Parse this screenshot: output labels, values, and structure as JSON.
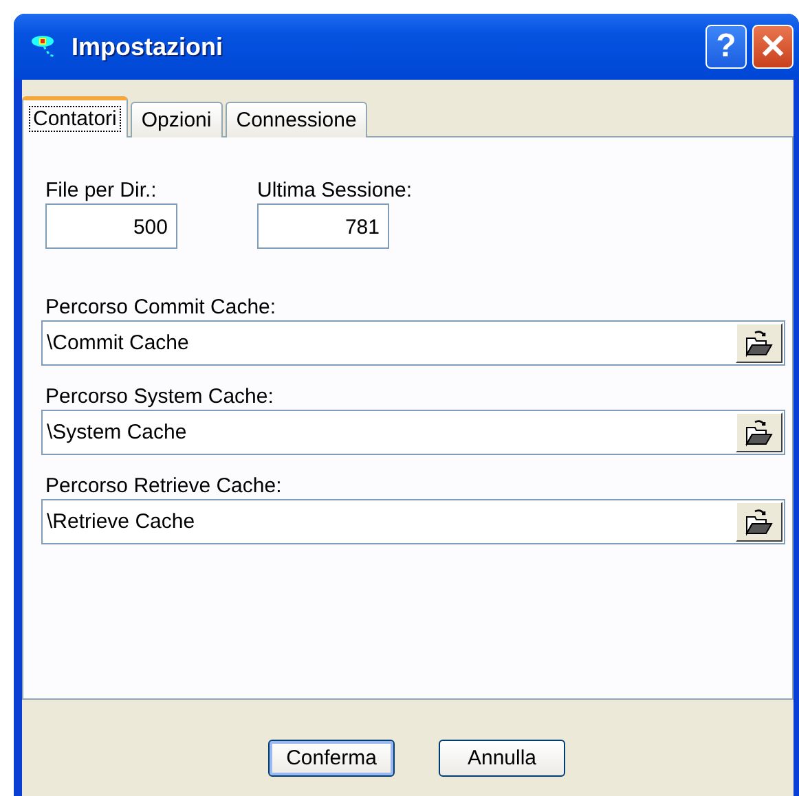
{
  "window": {
    "title": "Impostazioni"
  },
  "title_buttons": [
    {
      "kind": "help",
      "label": "?"
    },
    {
      "kind": "close",
      "label": "✕"
    }
  ],
  "tabs": [
    {
      "label": "Contatori",
      "selected": true
    },
    {
      "label": "Opzioni",
      "selected": false
    },
    {
      "label": "Connessione",
      "selected": false
    }
  ],
  "counters": [
    {
      "label": "File per Dir.:",
      "value": "500"
    },
    {
      "label": "Ultima Sessione:",
      "value": "781"
    }
  ],
  "paths": [
    {
      "label": "Percorso Commit Cache:",
      "value": "\\Commit Cache"
    },
    {
      "label": "Percorso System Cache:",
      "value": "\\System Cache"
    },
    {
      "label": "Percorso Retrieve Cache:",
      "value": "\\Retrieve Cache"
    }
  ],
  "buttons": [
    {
      "label": "Conferma",
      "default": true
    },
    {
      "label": "Annulla",
      "default": false
    }
  ]
}
